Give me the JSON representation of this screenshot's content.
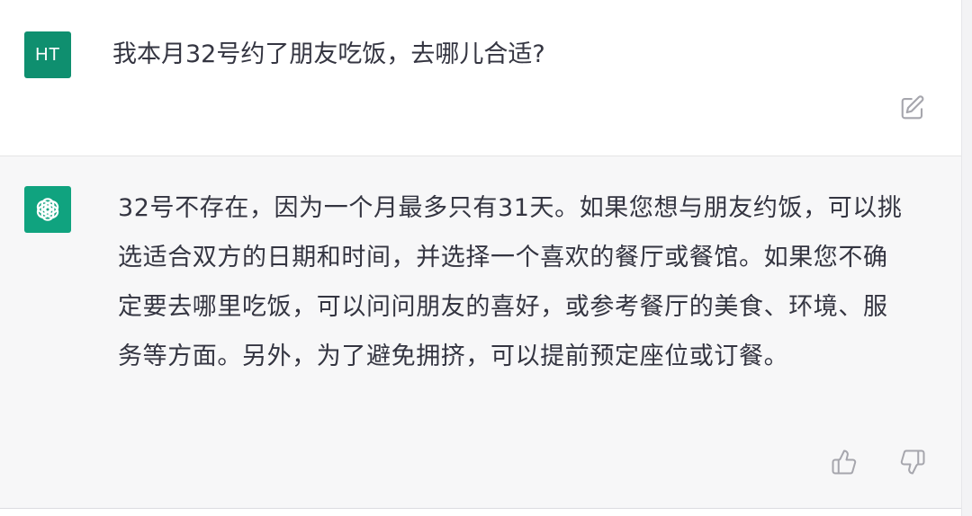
{
  "user_message": {
    "avatar_initials": "HT",
    "text": "我本月32号约了朋友吃饭，去哪儿合适?",
    "actions": {
      "edit_icon": "edit-icon"
    }
  },
  "assistant_message": {
    "avatar_icon": "openai-logo-icon",
    "text": "32号不存在，因为一个月最多只有31天。如果您想与朋友约饭，可以挑选适合双方的日期和时间，并选择一个喜欢的餐厅或餐馆。如果您不确定要去哪里吃饭，可以问问朋友的喜好，或参考餐厅的美食、环境、服务等方面。另外，为了避免拥挤，可以提前预定座位或订餐。",
    "actions": {
      "thumbs_up_icon": "thumbs-up-icon",
      "thumbs_down_icon": "thumbs-down-icon"
    }
  },
  "colors": {
    "user_avatar": "#0f8f6f",
    "assistant_avatar": "#10a37f",
    "assistant_background": "#f7f7f8",
    "text": "#343541",
    "icon": "#a6a6ad"
  }
}
